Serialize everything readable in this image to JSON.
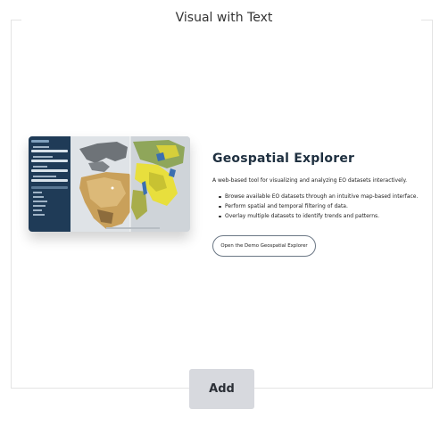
{
  "block": {
    "title": "Visual with Text"
  },
  "content": {
    "heading": "Geospatial Explorer",
    "description": "A web-based tool for visualizing and analyzing EO datasets interactively.",
    "bullets": [
      "Browse available EO datasets through an intuitive map-based interface.",
      "Perform spatial and temporal filtering of data.",
      "Overlay multiple datasets to identify trends and patterns."
    ],
    "cta_label": "Open the Demo Geospatial Explorer"
  },
  "actions": {
    "add_label": "Add"
  },
  "colors": {
    "heading": "#1f3040",
    "sidebar": "#1f3b57",
    "add_button_bg": "#d7d9de"
  }
}
